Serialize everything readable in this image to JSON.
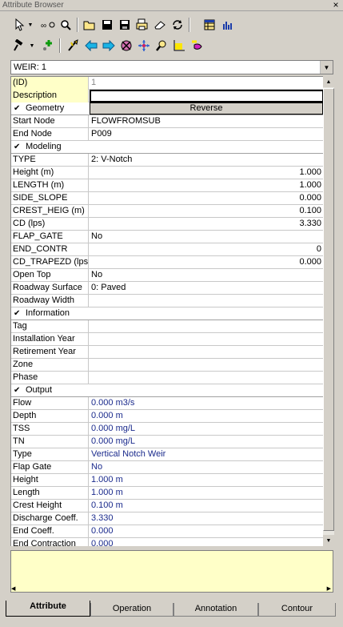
{
  "window": {
    "title": "Attribute Browser",
    "close_glyph": "×"
  },
  "toolbar1": [
    {
      "name": "pointer-icon"
    },
    {
      "name": "pointer-dropdown"
    },
    {
      "name": "link-icon"
    },
    {
      "name": "find-icon"
    },
    {
      "name": "open-icon"
    },
    {
      "name": "save-icon"
    },
    {
      "name": "save-as-icon"
    },
    {
      "name": "print-icon"
    },
    {
      "name": "erase-icon"
    },
    {
      "name": "refresh-icon"
    },
    {
      "name": "table-icon"
    },
    {
      "name": "chart-icon"
    }
  ],
  "toolbar2": [
    {
      "name": "hammer-icon"
    },
    {
      "name": "hammer-dropdown"
    },
    {
      "name": "add-node-icon"
    },
    {
      "name": "wand-icon"
    },
    {
      "name": "arrow-left-icon"
    },
    {
      "name": "arrow-right-icon"
    },
    {
      "name": "select-all-icon"
    },
    {
      "name": "center-icon"
    },
    {
      "name": "zoom-icon"
    },
    {
      "name": "plot-icon"
    },
    {
      "name": "paint-icon"
    }
  ],
  "combo": {
    "value": "WEIR: 1"
  },
  "rows": [
    {
      "t": "f",
      "n": "(ID)",
      "v": "1",
      "hl": true,
      "cls": "id"
    },
    {
      "t": "f",
      "n": "Description",
      "v": "",
      "hl": true,
      "cls": "desc"
    },
    {
      "t": "c",
      "n": "Geometry",
      "btn": "Reverse"
    },
    {
      "t": "f",
      "n": "Start Node",
      "v": "FLOWFROMSUB"
    },
    {
      "t": "f",
      "n": "End Node",
      "v": "P009"
    },
    {
      "t": "c",
      "n": "Modeling"
    },
    {
      "t": "f",
      "n": "TYPE",
      "v": "2: V-Notch"
    },
    {
      "t": "f",
      "n": "Height (m)",
      "v": "1.000",
      "r": true
    },
    {
      "t": "f",
      "n": "LENGTH (m)",
      "v": "1.000",
      "r": true
    },
    {
      "t": "f",
      "n": "SIDE_SLOPE",
      "v": "0.000",
      "r": true
    },
    {
      "t": "f",
      "n": "CREST_HEIG (m)",
      "v": "0.100",
      "r": true
    },
    {
      "t": "f",
      "n": "CD (lps)",
      "v": "3.330",
      "r": true
    },
    {
      "t": "f",
      "n": "FLAP_GATE",
      "v": "No"
    },
    {
      "t": "f",
      "n": "END_CONTR",
      "v": "0",
      "r": true
    },
    {
      "t": "f",
      "n": "CD_TRAPEZD (lps)",
      "v": "0.000",
      "r": true
    },
    {
      "t": "f",
      "n": "Open Top",
      "v": "No"
    },
    {
      "t": "f",
      "n": "Roadway Surface",
      "v": "0: Paved"
    },
    {
      "t": "f",
      "n": "Roadway Width",
      "v": ""
    },
    {
      "t": "c",
      "n": "Information"
    },
    {
      "t": "f",
      "n": "Tag",
      "v": ""
    },
    {
      "t": "f",
      "n": "Installation Year",
      "v": ""
    },
    {
      "t": "f",
      "n": "Retirement Year",
      "v": ""
    },
    {
      "t": "f",
      "n": "Zone",
      "v": ""
    },
    {
      "t": "f",
      "n": "Phase",
      "v": ""
    },
    {
      "t": "c",
      "n": "Output"
    },
    {
      "t": "f",
      "n": "Flow",
      "v": "0.000 m3/s",
      "b": true
    },
    {
      "t": "f",
      "n": "Depth",
      "v": "0.000 m",
      "b": true
    },
    {
      "t": "f",
      "n": "TSS",
      "v": "0.000 mg/L",
      "b": true
    },
    {
      "t": "f",
      "n": "TN",
      "v": "0.000 mg/L",
      "b": true
    },
    {
      "t": "f",
      "n": "Type",
      "v": "Vertical Notch Weir",
      "b": true
    },
    {
      "t": "f",
      "n": "Flap Gate",
      "v": "No",
      "b": true
    },
    {
      "t": "f",
      "n": "Height",
      "v": "1.000 m",
      "b": true
    },
    {
      "t": "f",
      "n": "Length",
      "v": "1.000 m",
      "b": true
    },
    {
      "t": "f",
      "n": "Crest Height",
      "v": "0.100 m",
      "b": true
    },
    {
      "t": "f",
      "n": "Discharge Coeff.",
      "v": "3.330",
      "b": true
    },
    {
      "t": "f",
      "n": "End Coeff.",
      "v": "0.000",
      "b": true
    },
    {
      "t": "f",
      "n": "End Contraction",
      "v": "0.000",
      "b": true
    }
  ],
  "tabs": [
    {
      "label": "Attribute",
      "active": true
    },
    {
      "label": "Operation"
    },
    {
      "label": "Annotation"
    },
    {
      "label": "Contour"
    }
  ]
}
